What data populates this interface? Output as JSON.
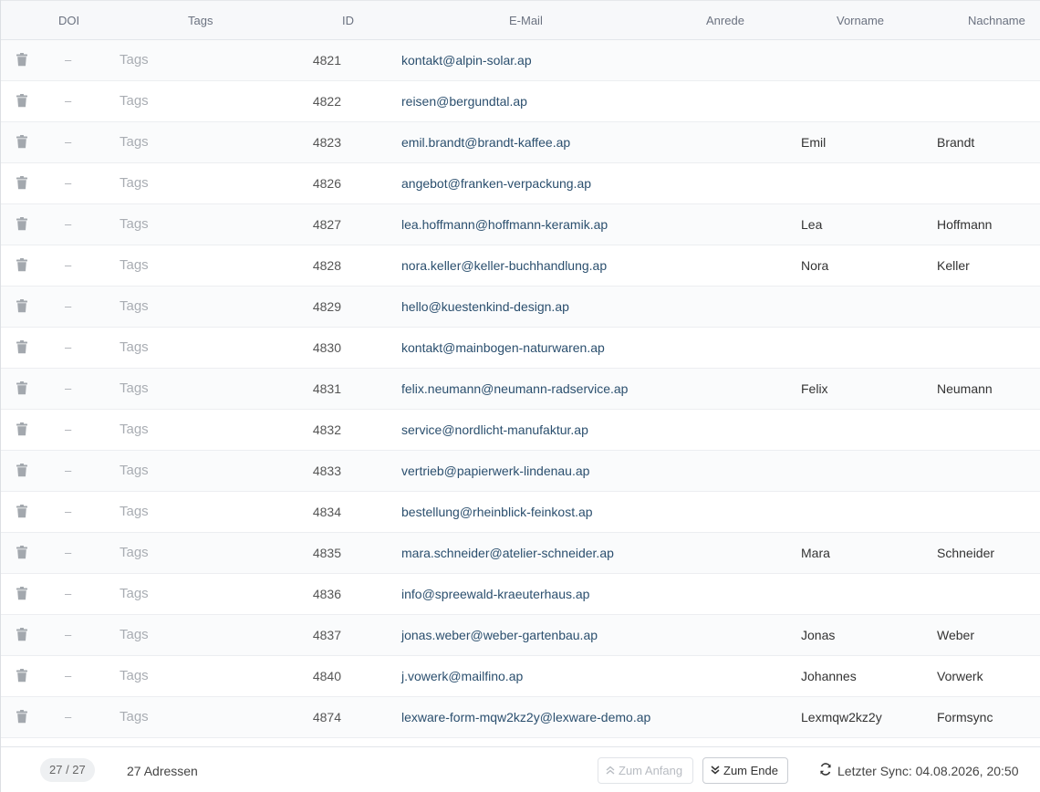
{
  "table": {
    "headers": {
      "doi": "DOI",
      "tags": "Tags",
      "id": "ID",
      "email": "E-Mail",
      "anrede": "Anrede",
      "vorname": "Vorname",
      "nachname": "Nachname"
    },
    "delete_icon": "trash-icon",
    "rows": [
      {
        "doi": "–",
        "tags": "Tags",
        "id": "4821",
        "email": "kontakt@alpin-solar.ap",
        "anrede": "",
        "vorname": "",
        "nachname": ""
      },
      {
        "doi": "–",
        "tags": "Tags",
        "id": "4822",
        "email": "reisen@bergundtal.ap",
        "anrede": "",
        "vorname": "",
        "nachname": ""
      },
      {
        "doi": "–",
        "tags": "Tags",
        "id": "4823",
        "email": "emil.brandt@brandt-kaffee.ap",
        "anrede": "",
        "vorname": "Emil",
        "nachname": "Brandt"
      },
      {
        "doi": "–",
        "tags": "Tags",
        "id": "4826",
        "email": "angebot@franken-verpackung.ap",
        "anrede": "",
        "vorname": "",
        "nachname": ""
      },
      {
        "doi": "–",
        "tags": "Tags",
        "id": "4827",
        "email": "lea.hoffmann@hoffmann-keramik.ap",
        "anrede": "",
        "vorname": "Lea",
        "nachname": "Hoffmann"
      },
      {
        "doi": "–",
        "tags": "Tags",
        "id": "4828",
        "email": "nora.keller@keller-buchhandlung.ap",
        "anrede": "",
        "vorname": "Nora",
        "nachname": "Keller"
      },
      {
        "doi": "–",
        "tags": "Tags",
        "id": "4829",
        "email": "hello@kuestenkind-design.ap",
        "anrede": "",
        "vorname": "",
        "nachname": ""
      },
      {
        "doi": "–",
        "tags": "Tags",
        "id": "4830",
        "email": "kontakt@mainbogen-naturwaren.ap",
        "anrede": "",
        "vorname": "",
        "nachname": ""
      },
      {
        "doi": "–",
        "tags": "Tags",
        "id": "4831",
        "email": "felix.neumann@neumann-radservice.ap",
        "anrede": "",
        "vorname": "Felix",
        "nachname": "Neumann"
      },
      {
        "doi": "–",
        "tags": "Tags",
        "id": "4832",
        "email": "service@nordlicht-manufaktur.ap",
        "anrede": "",
        "vorname": "",
        "nachname": ""
      },
      {
        "doi": "–",
        "tags": "Tags",
        "id": "4833",
        "email": "vertrieb@papierwerk-lindenau.ap",
        "anrede": "",
        "vorname": "",
        "nachname": ""
      },
      {
        "doi": "–",
        "tags": "Tags",
        "id": "4834",
        "email": "bestellung@rheinblick-feinkost.ap",
        "anrede": "",
        "vorname": "",
        "nachname": ""
      },
      {
        "doi": "–",
        "tags": "Tags",
        "id": "4835",
        "email": "mara.schneider@atelier-schneider.ap",
        "anrede": "",
        "vorname": "Mara",
        "nachname": "Schneider"
      },
      {
        "doi": "–",
        "tags": "Tags",
        "id": "4836",
        "email": "info@spreewald-kraeuterhaus.ap",
        "anrede": "",
        "vorname": "",
        "nachname": ""
      },
      {
        "doi": "–",
        "tags": "Tags",
        "id": "4837",
        "email": "jonas.weber@weber-gartenbau.ap",
        "anrede": "",
        "vorname": "Jonas",
        "nachname": "Weber"
      },
      {
        "doi": "–",
        "tags": "Tags",
        "id": "4840",
        "email": "j.vowerk@mailfino.ap",
        "anrede": "",
        "vorname": "Johannes",
        "nachname": "Vorwerk"
      },
      {
        "doi": "–",
        "tags": "Tags",
        "id": "4874",
        "email": "lexware-form-mqw2kz2y@lexware-demo.ap",
        "anrede": "",
        "vorname": "Lexmqw2kz2y",
        "nachname": "Formsync"
      }
    ]
  },
  "footer": {
    "count_badge": "27 / 27",
    "address_count": "27 Adressen",
    "to_start_label": "Zum Anfang",
    "to_start_icon": "double-chevron-up-icon",
    "to_end_label": "Zum Ende",
    "to_end_icon": "double-chevron-down-icon",
    "sync_icon": "refresh-icon",
    "last_sync": "Letzter Sync: 04.08.2026, 20:50"
  },
  "colors": {
    "email_text": "#2b4f6e",
    "muted": "#a9adb3",
    "header_bg": "#f7f8fa"
  }
}
